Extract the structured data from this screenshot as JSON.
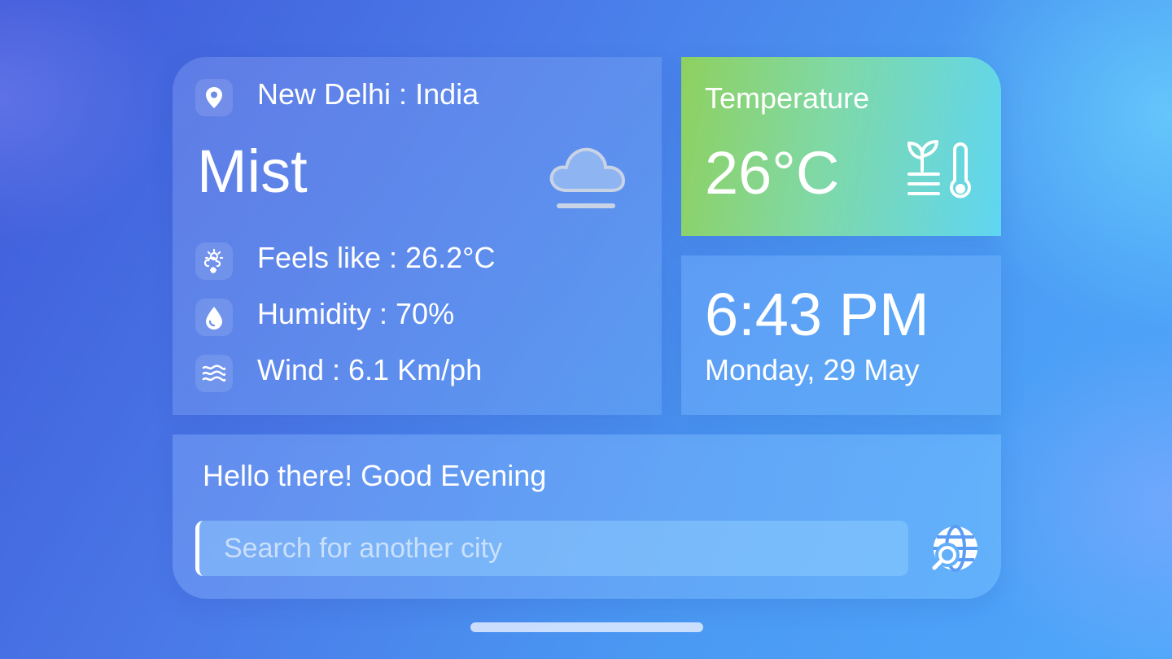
{
  "weather": {
    "location": "New Delhi : India",
    "condition": "Mist",
    "condition_icon": "cloud-mist-icon",
    "feels_like": "Feels like : 26.2°C",
    "humidity": "Humidity : 70%",
    "wind": "Wind : 6.1 Km/ph"
  },
  "temperature": {
    "label": "Temperature",
    "value": "26°C",
    "icon": "plant-thermometer-icon"
  },
  "clock": {
    "time": "6:43 PM",
    "date": "Monday, 29 May"
  },
  "greeting": {
    "text": "Hello there! Good Evening",
    "search_placeholder": "Search for another city",
    "search_value": ""
  },
  "colors": {
    "accent_green": "#8fd15f",
    "accent_cyan": "#5fd6f2",
    "background_blue": "#4a79e8"
  }
}
